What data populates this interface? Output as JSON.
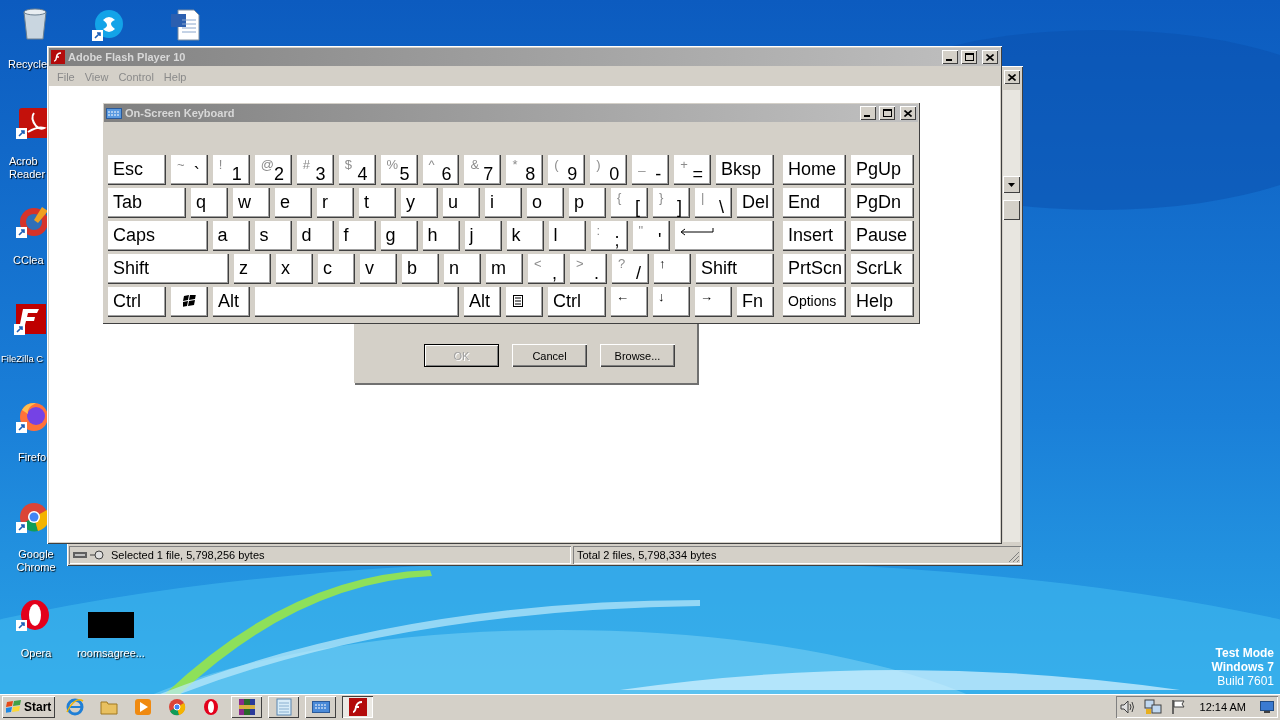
{
  "desktop": {
    "icons": [
      {
        "kind": "bin",
        "label": "Recycle"
      },
      {
        "kind": "skype"
      },
      {
        "kind": "word"
      },
      {
        "kind": "acrobat",
        "label": "Acrob Reader"
      },
      {
        "kind": "ccleaner",
        "label": "CClea"
      },
      {
        "kind": "filezilla",
        "label": "FileZilla C"
      },
      {
        "kind": "firefox",
        "label": "Firefo"
      },
      {
        "kind": "chrome",
        "label": "Google Chrome"
      },
      {
        "kind": "opera",
        "label": "Opera"
      },
      {
        "kind": "file",
        "label": "roomsagree..."
      }
    ],
    "test_mode": [
      "Test Mode",
      "Windows 7",
      "Build 7601"
    ]
  },
  "back_window": {
    "status_bar": [
      "Selected 1 file, 5,798,256 bytes",
      "Total 2 files, 5,798,334 bytes"
    ]
  },
  "flash_window": {
    "title": "Adobe Flash Player 10",
    "menu": [
      "File",
      "View",
      "Control",
      "Help"
    ]
  },
  "keyboard": {
    "title": "On-Screen Keyboard",
    "rows": [
      {
        "keys": [
          {
            "kind": "text",
            "label": "Esc"
          },
          {
            "kind": "dual",
            "shift": "~",
            "label": "`"
          },
          {
            "kind": "dual",
            "shift": "!",
            "label": "1"
          },
          {
            "kind": "dual",
            "shift": "@",
            "label": "2"
          },
          {
            "kind": "dual",
            "shift": "#",
            "label": "3"
          },
          {
            "kind": "dual",
            "shift": "$",
            "label": "4"
          },
          {
            "kind": "dual",
            "shift": "%",
            "label": "5"
          },
          {
            "kind": "dual",
            "shift": "^",
            "label": "6"
          },
          {
            "kind": "dual",
            "shift": "&",
            "label": "7"
          },
          {
            "kind": "dual",
            "shift": "*",
            "label": "8"
          },
          {
            "kind": "dual",
            "shift": "(",
            "label": "9"
          },
          {
            "kind": "dual",
            "shift": ")",
            "label": "0"
          },
          {
            "kind": "dual",
            "shift": "_",
            "label": "-"
          },
          {
            "kind": "dual",
            "shift": "+",
            "label": "="
          },
          {
            "kind": "text",
            "label": "Bksp"
          }
        ]
      },
      {
        "keys": [
          {
            "kind": "text",
            "label": "Tab"
          },
          {
            "kind": "text",
            "label": "q"
          },
          {
            "kind": "text",
            "label": "w"
          },
          {
            "kind": "text",
            "label": "e"
          },
          {
            "kind": "text",
            "label": "r"
          },
          {
            "kind": "text",
            "label": "t"
          },
          {
            "kind": "text",
            "label": "y"
          },
          {
            "kind": "text",
            "label": "u"
          },
          {
            "kind": "text",
            "label": "i"
          },
          {
            "kind": "text",
            "label": "o"
          },
          {
            "kind": "text",
            "label": "p"
          },
          {
            "kind": "dual",
            "shift": "{",
            "label": "["
          },
          {
            "kind": "dual",
            "shift": "}",
            "label": "]"
          },
          {
            "kind": "dual",
            "shift": "|",
            "label": "\\"
          },
          {
            "kind": "text",
            "label": "Del"
          }
        ]
      },
      {
        "keys": [
          {
            "kind": "text",
            "label": "Caps"
          },
          {
            "kind": "text",
            "label": "a"
          },
          {
            "kind": "text",
            "label": "s"
          },
          {
            "kind": "text",
            "label": "d"
          },
          {
            "kind": "text",
            "label": "f"
          },
          {
            "kind": "text",
            "label": "g"
          },
          {
            "kind": "text",
            "label": "h"
          },
          {
            "kind": "text",
            "label": "j"
          },
          {
            "kind": "text",
            "label": "k"
          },
          {
            "kind": "text",
            "label": "l"
          },
          {
            "kind": "dual",
            "shift": ":",
            "label": ";"
          },
          {
            "kind": "dual",
            "shift": "\"",
            "label": "'"
          },
          {
            "kind": "enter"
          }
        ]
      },
      {
        "keys": [
          {
            "kind": "text",
            "label": "Shift"
          },
          {
            "kind": "text",
            "label": "z"
          },
          {
            "kind": "text",
            "label": "x"
          },
          {
            "kind": "text",
            "label": "c"
          },
          {
            "kind": "text",
            "label": "v"
          },
          {
            "kind": "text",
            "label": "b"
          },
          {
            "kind": "text",
            "label": "n"
          },
          {
            "kind": "text",
            "label": "m"
          },
          {
            "kind": "dual",
            "shift": "<",
            "label": ","
          },
          {
            "kind": "dual",
            "shift": ">",
            "label": "."
          },
          {
            "kind": "dual",
            "shift": "?",
            "label": "/"
          },
          {
            "kind": "arrow",
            "label": "↑"
          },
          {
            "kind": "text",
            "label": "Shift"
          }
        ]
      },
      {
        "keys": [
          {
            "kind": "text",
            "label": "Ctrl"
          },
          {
            "kind": "windows"
          },
          {
            "kind": "text",
            "label": "Alt"
          },
          {
            "kind": "space"
          },
          {
            "kind": "text",
            "label": "Alt"
          },
          {
            "kind": "menu"
          },
          {
            "kind": "text",
            "label": "Ctrl"
          },
          {
            "kind": "arrow",
            "label": "←"
          },
          {
            "kind": "arrow",
            "label": "↓"
          },
          {
            "kind": "arrow",
            "label": "→"
          },
          {
            "kind": "text",
            "label": "Fn"
          }
        ]
      }
    ],
    "nav_rows": [
      {
        "keys": [
          {
            "kind": "text",
            "label": "Home"
          },
          {
            "kind": "text",
            "label": "PgUp"
          }
        ]
      },
      {
        "keys": [
          {
            "kind": "text",
            "label": "End"
          },
          {
            "kind": "text",
            "label": "PgDn"
          }
        ]
      },
      {
        "keys": [
          {
            "kind": "text",
            "label": "Insert"
          },
          {
            "kind": "text",
            "label": "Pause"
          }
        ]
      },
      {
        "keys": [
          {
            "kind": "text",
            "label": "PrtScn"
          },
          {
            "kind": "text",
            "label": "ScrLk"
          }
        ]
      },
      {
        "keys": [
          {
            "kind": "small",
            "label": "Options"
          },
          {
            "kind": "text",
            "label": "Help"
          }
        ]
      }
    ]
  },
  "dialog": {
    "buttons": [
      {
        "label": "OK",
        "disabled": true
      },
      {
        "label": "Cancel",
        "disabled": false
      },
      {
        "label": "Browse...",
        "disabled": false
      }
    ]
  },
  "taskbar": {
    "start": "Start",
    "quick_launch": [
      {
        "kind": "ie"
      },
      {
        "kind": "folder"
      },
      {
        "kind": "media"
      },
      {
        "kind": "chrome"
      },
      {
        "kind": "opera"
      }
    ],
    "tasks": [
      {
        "kind": "archive",
        "selected": false
      },
      {
        "kind": "notepad",
        "selected": false
      },
      {
        "kind": "keyboard",
        "selected": false
      },
      {
        "kind": "flash",
        "selected": true
      }
    ],
    "clock": "12:14 AM"
  }
}
